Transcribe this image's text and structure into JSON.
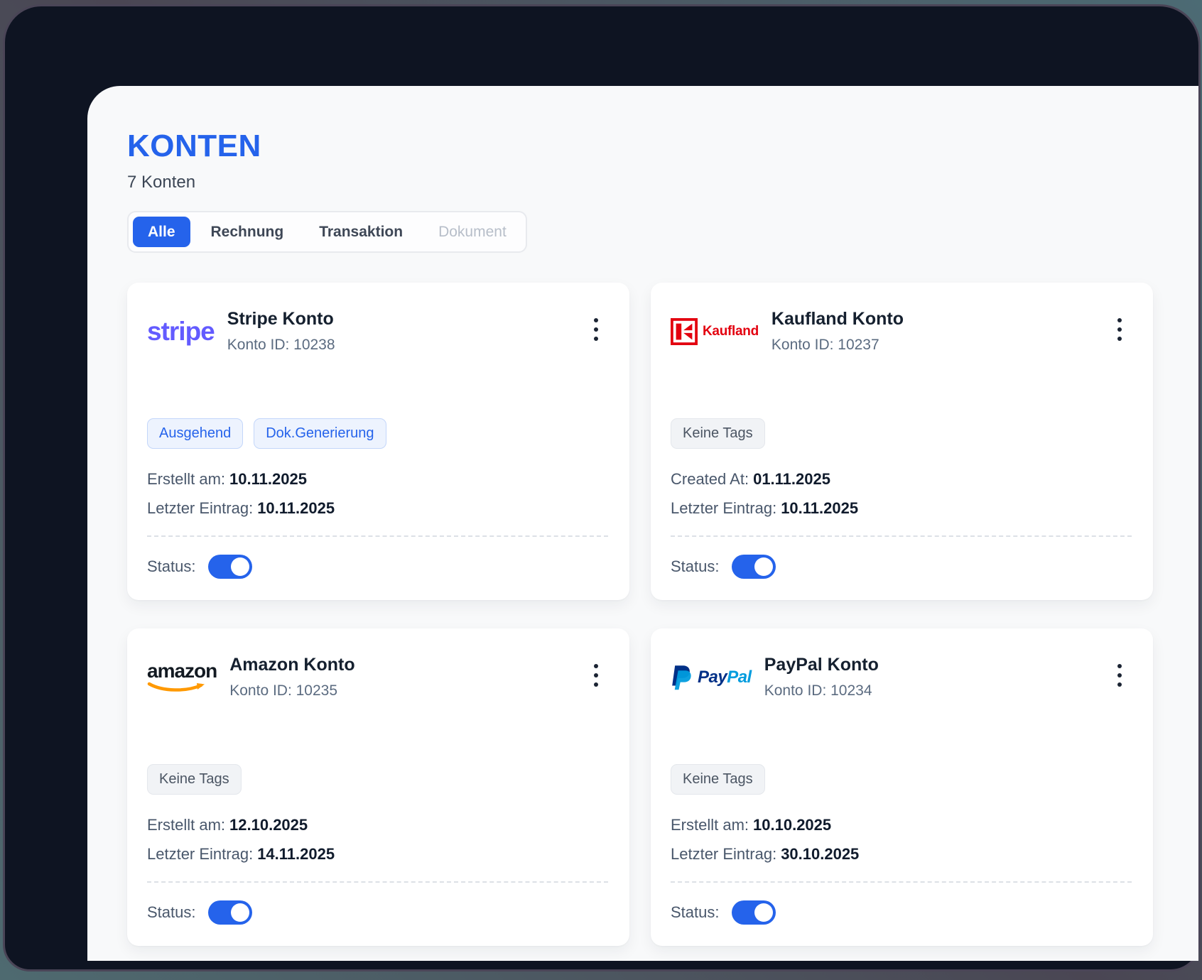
{
  "page": {
    "title": "KONTEN",
    "subtitle": "7 Konten"
  },
  "filters": {
    "items": [
      {
        "label": "Alle",
        "state": "active"
      },
      {
        "label": "Rechnung",
        "state": "default"
      },
      {
        "label": "Transaktion",
        "state": "default"
      },
      {
        "label": "Dokument",
        "state": "disabled"
      }
    ]
  },
  "accounts": [
    {
      "logo_icon": "stripe-logo",
      "name": "Stripe Konto",
      "konto_id": "Konto ID: 10238",
      "tags": [
        {
          "label": "Ausgehend",
          "variant": "blue"
        },
        {
          "label": "Dok.Generierung",
          "variant": "blue"
        }
      ],
      "fields": [
        {
          "label": "Erstellt am:",
          "value": "10.11.2025"
        },
        {
          "label": "Letzter Eintrag:",
          "value": "10.11.2025"
        }
      ],
      "status_label": "Status:",
      "status_on": true
    },
    {
      "logo_icon": "kaufland-logo",
      "name": "Kaufland Konto",
      "konto_id": "Konto ID: 10237",
      "tags": [
        {
          "label": "Keine Tags",
          "variant": "gray"
        }
      ],
      "fields": [
        {
          "label": "Created At:",
          "value": "01.11.2025"
        },
        {
          "label": "Letzter Eintrag:",
          "value": "10.11.2025"
        }
      ],
      "status_label": "Status:",
      "status_on": true
    },
    {
      "logo_icon": "amazon-logo",
      "name": "Amazon Konto",
      "konto_id": "Konto ID: 10235",
      "tags": [
        {
          "label": "Keine Tags",
          "variant": "gray"
        }
      ],
      "fields": [
        {
          "label": "Erstellt am:",
          "value": "12.10.2025"
        },
        {
          "label": "Letzter Eintrag:",
          "value": "14.11.2025"
        }
      ],
      "status_label": "Status:",
      "status_on": true
    },
    {
      "logo_icon": "paypal-logo",
      "name": "PayPal Konto",
      "konto_id": "Konto ID: 10234",
      "tags": [
        {
          "label": "Keine Tags",
          "variant": "gray"
        }
      ],
      "fields": [
        {
          "label": "Erstellt am:",
          "value": "10.10.2025"
        },
        {
          "label": "Letzter Eintrag:",
          "value": "30.10.2025"
        }
      ],
      "status_label": "Status:",
      "status_on": true
    }
  ],
  "logo_text": {
    "stripe": "stripe",
    "kaufland": "Kaufland",
    "amazon": "amazon",
    "paypal_pay": "Pay",
    "paypal_pal": "Pal"
  },
  "colors": {
    "accent": "#2563EB",
    "title": "#2563EB",
    "panel_bg": "#F8F9FA",
    "window_bg": "#0E1422",
    "stripe_purple": "#635BFF",
    "kaufland_red": "#E3000F",
    "amazon_orange": "#FF9900",
    "paypal_dark_blue": "#003087",
    "paypal_light_blue": "#009CDE"
  }
}
